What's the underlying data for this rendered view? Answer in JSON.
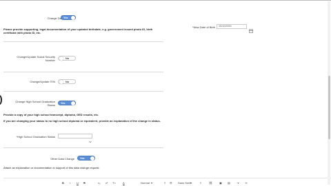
{
  "toggle_on": "Yes",
  "toggle_off": "No",
  "dob": {
    "label": "Change Date of Birth",
    "instructions": "Please provide supporting, legal documentation of your updated birthdate, e.g. government issued photo ID, birth certificate with photo ID, etc.",
    "new_label": "*New Date of Birth",
    "new_value": "10/10/2001"
  },
  "ssn": {
    "label": "Change/Update Social Security Number"
  },
  "itin": {
    "label": "Change/Update ITIN"
  },
  "hs": {
    "label": "Change High School Graduation Status",
    "instructions1": "Provide a copy of your high school transcript, diploma, GED results, etc.",
    "instructions2": "If you are changing your status to no high school diploma or equivalent, provide an explanation of the change in status.",
    "status_label": "*High School Graduation Status",
    "status_value": ""
  },
  "other": {
    "label": "Other Data Change",
    "instructions": "Attach an explanation or documentation in support of this data change request."
  },
  "editor": {
    "bold": "B",
    "italic": "I",
    "underline": "U",
    "strike": "S",
    "subscript": "x₂",
    "superscript": "x²",
    "clear": "T×",
    "format_value": "Normal",
    "font_value": "Sans Serif"
  }
}
